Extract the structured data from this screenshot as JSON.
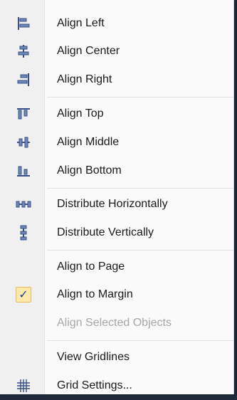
{
  "menu": {
    "items": [
      {
        "id": "align-left",
        "label": "Align Left",
        "icon": "align-left-icon",
        "disabled": false
      },
      {
        "id": "align-center",
        "label": "Align Center",
        "icon": "align-center-icon",
        "disabled": false
      },
      {
        "id": "align-right",
        "label": "Align Right",
        "icon": "align-right-icon",
        "disabled": false
      },
      {
        "id": "align-top",
        "label": "Align Top",
        "icon": "align-top-icon",
        "disabled": false
      },
      {
        "id": "align-middle",
        "label": "Align Middle",
        "icon": "align-middle-icon",
        "disabled": false
      },
      {
        "id": "align-bottom",
        "label": "Align Bottom",
        "icon": "align-bottom-icon",
        "disabled": false
      },
      {
        "id": "distribute-horizontally",
        "label": "Distribute Horizontally",
        "icon": "distribute-horizontally-icon",
        "disabled": false
      },
      {
        "id": "distribute-vertically",
        "label": "Distribute Vertically",
        "icon": "distribute-vertically-icon",
        "disabled": false
      },
      {
        "id": "align-to-page",
        "label": "Align to Page",
        "icon": "",
        "disabled": false
      },
      {
        "id": "align-to-margin",
        "label": "Align to Margin",
        "icon": "check-icon",
        "checked": true,
        "disabled": false
      },
      {
        "id": "align-selected-objects",
        "label": "Align Selected Objects",
        "icon": "",
        "disabled": true
      },
      {
        "id": "view-gridlines",
        "label": "View Gridlines",
        "icon": "",
        "disabled": false
      },
      {
        "id": "grid-settings",
        "label": "Grid Settings...",
        "icon": "grid-icon",
        "disabled": false
      }
    ]
  },
  "colors": {
    "background": "#1f2a3a",
    "menu": "#fafafa",
    "gutter": "#f0f0f0",
    "icon_blue": "#3a4f86",
    "check_bg": "#fde9a9",
    "check_border": "#e2b865",
    "disabled_text": "#a7a7a7"
  }
}
